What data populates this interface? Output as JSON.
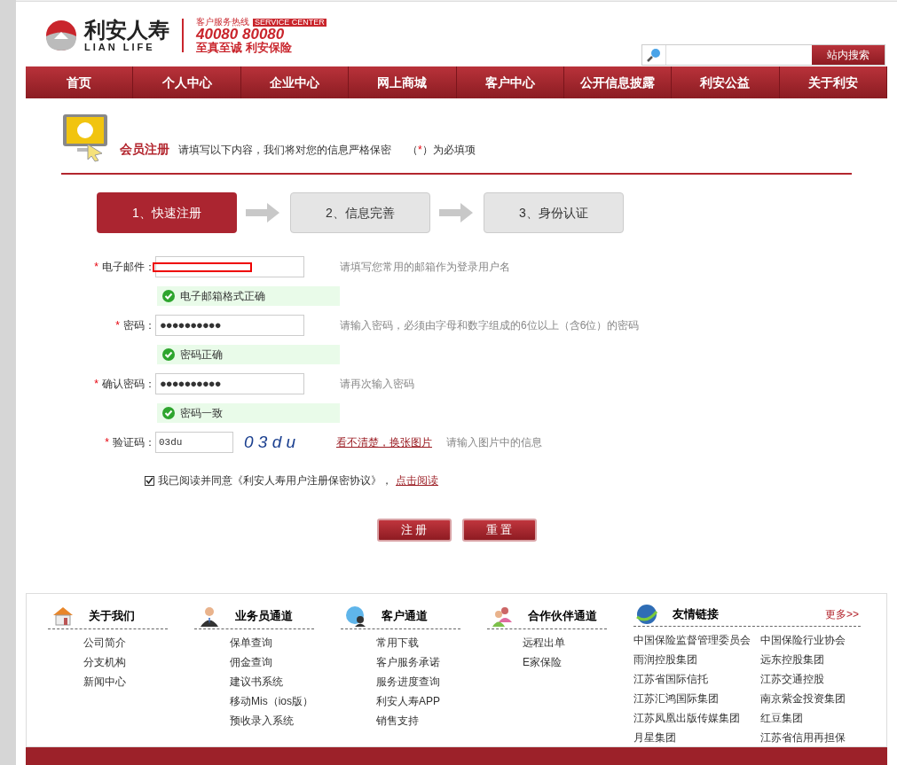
{
  "header": {
    "brand": "利安人寿",
    "brand_en": "LIAN LIFE",
    "hotline_label": "客户服务热线",
    "hotline_tag": "SERVICE CENTER",
    "hotline": "40080 80080",
    "slogan": "至真至诚 利安保险",
    "search_button": "站内搜索"
  },
  "nav": [
    "首页",
    "个人中心",
    "企业中心",
    "网上商城",
    "客户中心",
    "公开信息披露",
    "利安公益",
    "关于利安"
  ],
  "intro": {
    "title": "会员注册",
    "text": "请填写以下内容，我们将对您的信息严格保密",
    "req_open": "（",
    "req_mark": "*",
    "req_close": "）为必填项"
  },
  "steps": [
    {
      "label": "1、快速注册",
      "selected": true
    },
    {
      "label": "2、信息完善",
      "selected": false
    },
    {
      "label": "3、身份认证",
      "selected": false
    }
  ],
  "fields": [
    {
      "kind": "email",
      "label": "电子邮件：",
      "required": true,
      "hint": "请填写您常用的邮箱作为登录用户名",
      "status": "电子邮箱格式正确"
    },
    {
      "kind": "password",
      "label": "密码：",
      "required": true,
      "value": "●●●●●●●●●●",
      "hint": "请输入密码，必须由字母和数字组成的6位以上（含6位）的密码",
      "status": "密码正确"
    },
    {
      "kind": "password",
      "label": "确认密码：",
      "required": true,
      "value": "●●●●●●●●●●",
      "hint": "请再次输入密码",
      "status": "密码一致"
    },
    {
      "kind": "captcha",
      "label": "验证码：",
      "required": true,
      "value": "03du",
      "captcha": "0 3 d u",
      "refresh": "看不清楚，换张图片",
      "hint": "请输入图片中的信息"
    }
  ],
  "agreement": {
    "checked": true,
    "text": "我已阅读并同意《利安人寿用户注册保密协议》，",
    "link": "点击阅读"
  },
  "buttons": [
    "注 册",
    "重 置"
  ],
  "footer": {
    "columns": [
      {
        "title": "关于我们",
        "links": [
          "公司简介",
          "分支机构",
          "新闻中心"
        ]
      },
      {
        "title": "业务员通道",
        "links": [
          "保单查询",
          "佣金查询",
          "建议书系统",
          "移动Mis（ios版）",
          "预收录入系统"
        ]
      },
      {
        "title": "客户通道",
        "links": [
          "常用下载",
          "客户服务承诺",
          "服务进度查询",
          "利安人寿APP",
          "销售支持"
        ]
      },
      {
        "title": "合作伙伴通道",
        "links": [
          "远程出单",
          "E家保险"
        ]
      }
    ],
    "friends": {
      "title": "友情链接",
      "more": "更多>>",
      "links": [
        "中国保险监督管理委员会",
        "中国保险行业协会",
        "雨润控股集团",
        "远东控股集团",
        "江苏省国际信托",
        "江苏交通控股",
        "江苏汇鸿国际集团",
        "南京紫金投资集团",
        "江苏凤凰出版传媒集团",
        "红豆集团",
        "月星集团",
        "江苏省信用再担保"
      ]
    }
  }
}
